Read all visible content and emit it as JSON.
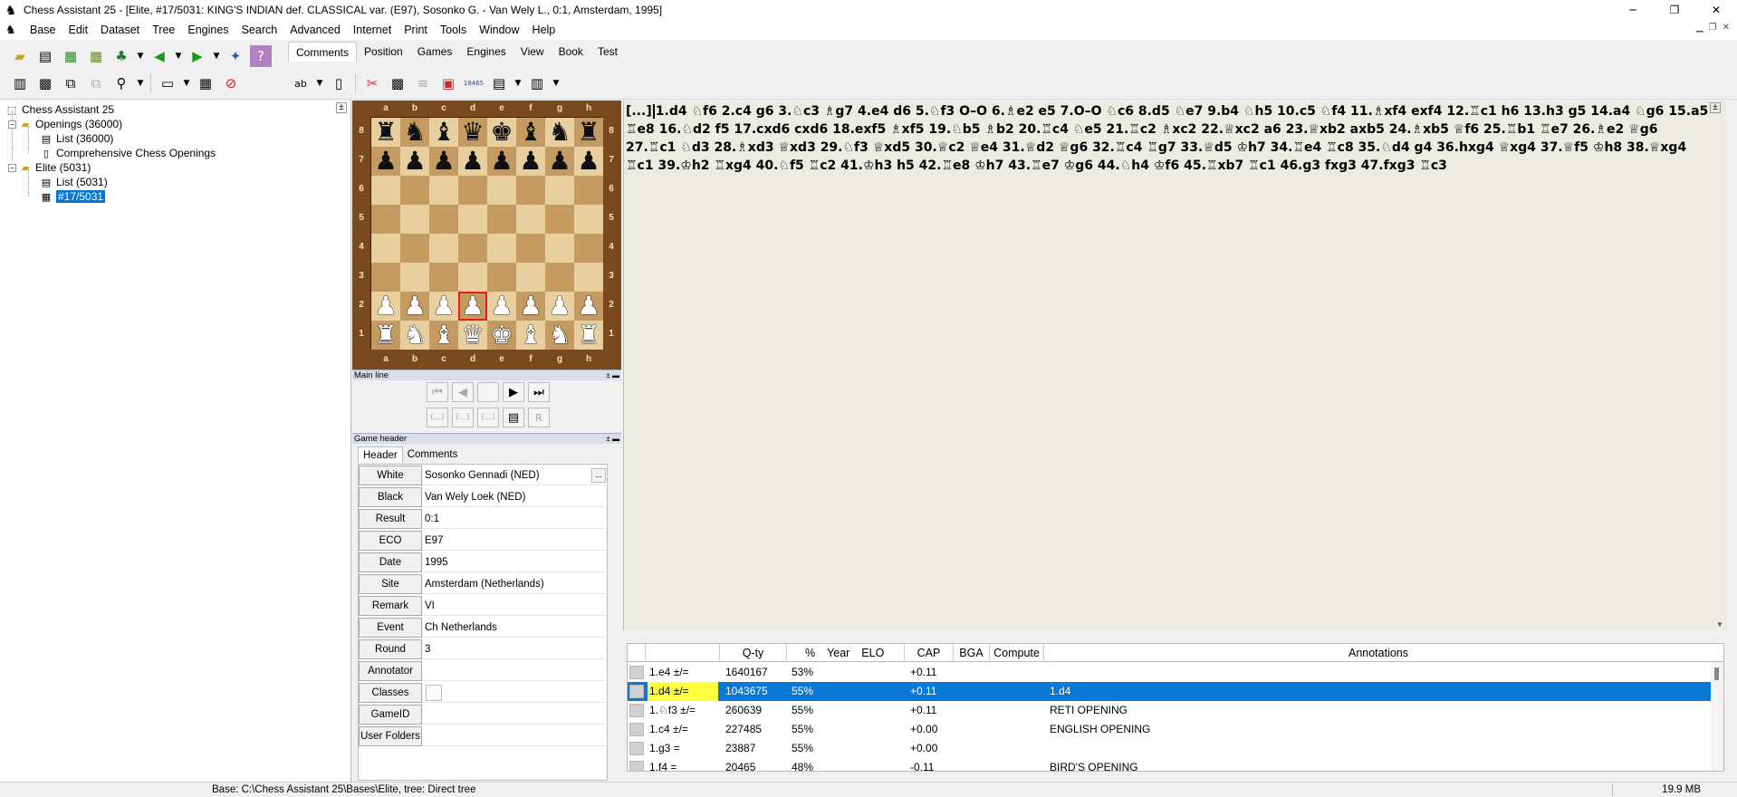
{
  "window": {
    "title": "Chess Assistant 25 - [Elite, #17/5031: KING'S INDIAN def. CLASSICAL var. (E97), Sosonko G. - Van Wely L., 0:1, Amsterdam, 1995]",
    "minimize_glyph": "─",
    "maximize_glyph": "❐",
    "close_glyph": "✕"
  },
  "menu": [
    "Base",
    "Edit",
    "Dataset",
    "Tree",
    "Engines",
    "Search",
    "Advanced",
    "Internet",
    "Print",
    "Tools",
    "Window",
    "Help"
  ],
  "toolbar": {
    "tabs": [
      "Comments",
      "Position",
      "Games",
      "Engines",
      "View",
      "Book",
      "Test"
    ],
    "active_tab": "Comments",
    "counter_label": "18465"
  },
  "tree": {
    "root": "Chess Assistant 25",
    "openings": "Openings (36000)",
    "openings_list": "List (36000)",
    "openings_comp": "Comprehensive Chess Openings",
    "elite": "Elite (5031)",
    "elite_list": "List (5031)",
    "elite_game": "#17/5031"
  },
  "board": {
    "files": [
      "a",
      "b",
      "c",
      "d",
      "e",
      "f",
      "g",
      "h"
    ],
    "ranks": [
      "8",
      "7",
      "6",
      "5",
      "4",
      "3",
      "2",
      "1"
    ],
    "position": [
      [
        "r",
        "n",
        "b",
        "q",
        "k",
        "b",
        "n",
        "r"
      ],
      [
        "p",
        "p",
        "p",
        "p",
        "p",
        "p",
        "p",
        "p"
      ],
      [
        "",
        "",
        "",
        "",
        "",
        "",
        "",
        ""
      ],
      [
        "",
        "",
        "",
        "",
        "",
        "",
        "",
        ""
      ],
      [
        "",
        "",
        "",
        "",
        "",
        "",
        "",
        ""
      ],
      [
        "",
        "",
        "",
        "",
        "",
        "",
        "",
        ""
      ],
      [
        "P",
        "P",
        "P",
        "P",
        "P",
        "P",
        "P",
        "P"
      ],
      [
        "R",
        "N",
        "B",
        "Q",
        "K",
        "B",
        "N",
        "R"
      ]
    ],
    "highlight": "d2"
  },
  "panels": {
    "main_line": "Main line",
    "game_header": "Game header"
  },
  "nav": {
    "first": "⏮",
    "prev": "◀",
    "next": "▶",
    "last": "⏭",
    "var1": "(...)",
    "var2": "(...)",
    "var3": "(...)"
  },
  "game_header": {
    "tabs": [
      "Header",
      "Comments"
    ],
    "rows": [
      {
        "label": "White",
        "value": "Sosonko Gennadi (NED)"
      },
      {
        "label": "Black",
        "value": "Van Wely Loek (NED)"
      },
      {
        "label": "Result",
        "value": "0:1"
      },
      {
        "label": "ECO",
        "value": "E97"
      },
      {
        "label": "Date",
        "value": "1995"
      },
      {
        "label": "Site",
        "value": "Amsterdam (Netherlands)"
      },
      {
        "label": "Remark",
        "value": "VI"
      },
      {
        "label": "Event",
        "value": "Ch Netherlands"
      },
      {
        "label": "Round",
        "value": "3"
      },
      {
        "label": "Annotator",
        "value": ""
      },
      {
        "label": "Classes",
        "value": ""
      },
      {
        "label": "GameID",
        "value": ""
      },
      {
        "label": "User Folders",
        "value": ""
      }
    ],
    "dots": "..."
  },
  "notation": {
    "prefix": "[...]",
    "moves": "1.d4 ♘f6 2.c4 g6 3.♘c3 ♗g7 4.e4 d6 5.♘f3 O–O 6.♗e2 e5 7.O–O ♘c6 8.d5 ♘e7 9.b4 ♘h5 10.c5 ♘f4 11.♗xf4 exf4 12.♖c1 h6 13.h3 g5 14.a4 ♘g6 15.a5 ♖e8 16.♘d2 f5 17.cxd6 cxd6 18.exf5 ♗xf5 19.♘b5 ♗b2 20.♖c4 ♘e5 21.♖c2 ♗xc2 22.♕xc2 a6 23.♕xb2 axb5 24.♗xb5 ♕f6 25.♖b1 ♖e7 26.♗e2 ♕g6 27.♖c1 ♘d3 28.♗xd3 ♕xd3 29.♘f3 ♕xd5 30.♕c2 ♕e4 31.♕d2 ♕g6 32.♖c4 ♖g7 33.♕d5 ♔h7 34.♖e4 ♖c8 35.♘d4 g4 36.hxg4 ♕xg4 37.♕f5 ♔h8 38.♕xg4 ♖c1 39.♔h2 ♖xg4 40.♘f5 ♖c2 41.♔h3 h5 42.♖e8 ♔h7 43.♖e7 ♔g6 44.♘h4 ♔f6 45.♖xb7 ♖c1 46.g3 fxg3 47.fxg3 ♖c3"
  },
  "tree_table": {
    "columns": [
      "",
      "Q-ty",
      "%",
      "Year",
      "ELO",
      "CAP",
      "BGA",
      "Compute",
      "Annotations"
    ],
    "rows": [
      {
        "move": "1.e4 ±/=",
        "qty": "1640167",
        "pct": "53%",
        "cap": "+0.11",
        "ann": "",
        "selected": false
      },
      {
        "move": "1.d4 ±/=",
        "qty": "1043675",
        "pct": "55%",
        "cap": "+0.11",
        "ann": "1.d4",
        "selected": true
      },
      {
        "move": "1.♘f3 ±/=",
        "qty": "260639",
        "pct": "55%",
        "cap": "+0.11",
        "ann": "RETI OPENING",
        "selected": false
      },
      {
        "move": "1.c4 ±/=",
        "qty": "227485",
        "pct": "55%",
        "cap": "+0.00",
        "ann": "ENGLISH OPENING",
        "selected": false
      },
      {
        "move": "1.g3 =",
        "qty": "23887",
        "pct": "55%",
        "cap": "+0.00",
        "ann": "",
        "selected": false
      },
      {
        "move": "1.f4 =",
        "qty": "20465",
        "pct": "48%",
        "cap": "-0.11",
        "ann": "BIRD'S OPENING",
        "selected": false
      }
    ]
  },
  "status": {
    "main": "Base: C:\\Chess Assistant 25\\Bases\\Elite, tree: Direct tree",
    "memory": "19.9 MB"
  },
  "colors": {
    "selection": "#0078d7",
    "board_light": "#e8cfa0",
    "board_dark": "#c49a60",
    "board_frame": "#7a4a1e",
    "highlight_yellow": "#ffff40"
  }
}
